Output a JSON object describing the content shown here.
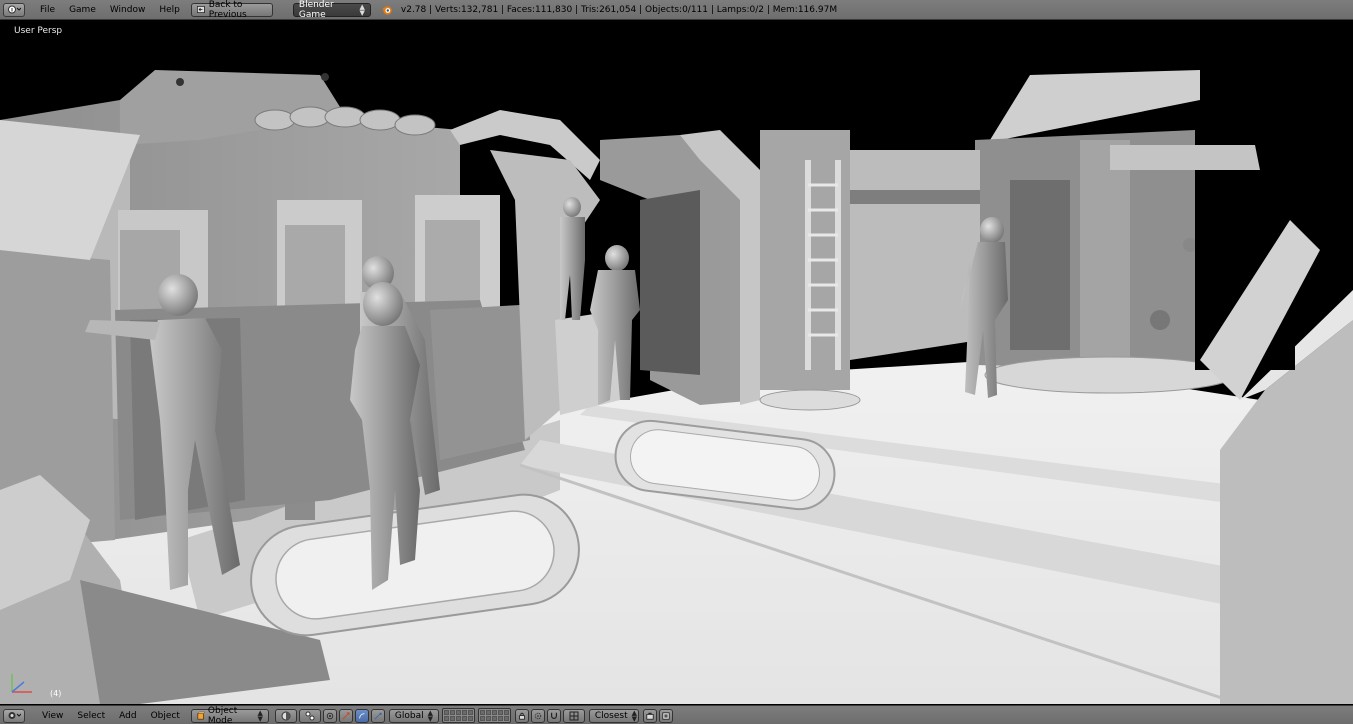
{
  "topbar": {
    "menus": [
      "File",
      "Game",
      "Window",
      "Help"
    ],
    "back_label": "Back to Previous",
    "engine": "Blender Game",
    "stats": "v2.78 | Verts:132,781 | Faces:111,830 | Tris:261,054 | Objects:0/111 | Lamps:0/2 | Mem:116.97M"
  },
  "viewport": {
    "label": "User Persp",
    "object_label": "(4)"
  },
  "bottombar": {
    "menus": [
      "View",
      "Select",
      "Add",
      "Object"
    ],
    "mode": "Object Mode",
    "orientation": "Global",
    "snap_target": "Closest"
  },
  "colors": {
    "header": "#727272",
    "viewport_bg": "#000000",
    "accent_blue": "#5a7fbd"
  }
}
